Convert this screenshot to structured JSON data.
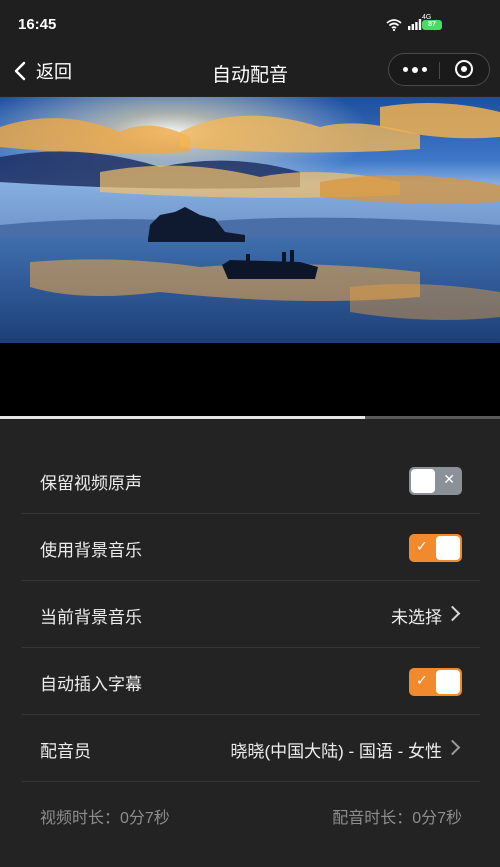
{
  "status_bar": {
    "time": "16:45",
    "network": "4G",
    "battery": "87"
  },
  "nav": {
    "back_label": "返回",
    "title": "自动配音"
  },
  "video": {
    "progress_fraction": 0.73
  },
  "settings": {
    "keep_original": {
      "label": "保留视频原声",
      "enabled": false
    },
    "bg_music": {
      "label": "使用背景音乐",
      "enabled": true
    },
    "current_music": {
      "label": "当前背景音乐",
      "value": "未选择"
    },
    "auto_subtitle": {
      "label": "自动插入字幕",
      "enabled": true
    },
    "voice_actor": {
      "label": "配音员",
      "value": "晓晓(中国大陆) - 国语 - 女性"
    }
  },
  "toggle_marks": {
    "on": "✓",
    "off": "✕"
  },
  "footer": {
    "video_duration": "视频时长：0分7秒",
    "dub_duration": "配音时长：0分7秒"
  },
  "colors": {
    "accent": "#f08a2c",
    "toggle_off": "#8b9199",
    "background": "#232323"
  }
}
